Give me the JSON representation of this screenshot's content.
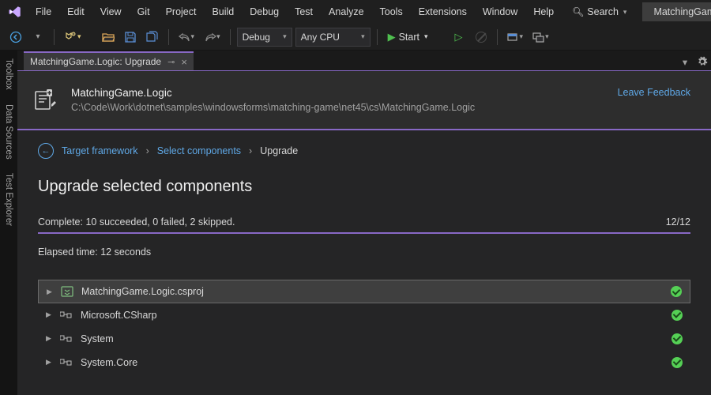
{
  "menubar": {
    "items": [
      "File",
      "Edit",
      "View",
      "Git",
      "Project",
      "Build",
      "Debug",
      "Test",
      "Analyze",
      "Tools",
      "Extensions",
      "Window",
      "Help"
    ],
    "search_label": "Search",
    "solution_label": "MatchingGame"
  },
  "toolbar": {
    "config_label": "Debug",
    "platform_label": "Any CPU",
    "start_label": "Start"
  },
  "side_tabs": [
    "Toolbox",
    "Data Sources",
    "Test Explorer"
  ],
  "doc_tab": {
    "title": "MatchingGame.Logic: Upgrade"
  },
  "header": {
    "project_name": "MatchingGame.Logic",
    "project_path": "C:\\Code\\Work\\dotnet\\samples\\windowsforms\\matching-game\\net45\\cs\\MatchingGame.Logic",
    "feedback_label": "Leave Feedback"
  },
  "breadcrumb": {
    "back_icon": "←",
    "link1": "Target framework",
    "link2": "Select components",
    "current": "Upgrade"
  },
  "page": {
    "title": "Upgrade selected components",
    "progress_text": "Complete: 10 succeeded, 0 failed, 2 skipped.",
    "progress_count": "12/12",
    "elapsed_text": "Elapsed time: 12 seconds"
  },
  "results": [
    {
      "name": "MatchingGame.Logic.csproj",
      "kind": "project",
      "status": "ok"
    },
    {
      "name": "Microsoft.CSharp",
      "kind": "ref",
      "status": "ok"
    },
    {
      "name": "System",
      "kind": "ref",
      "status": "ok"
    },
    {
      "name": "System.Core",
      "kind": "ref",
      "status": "ok"
    }
  ]
}
